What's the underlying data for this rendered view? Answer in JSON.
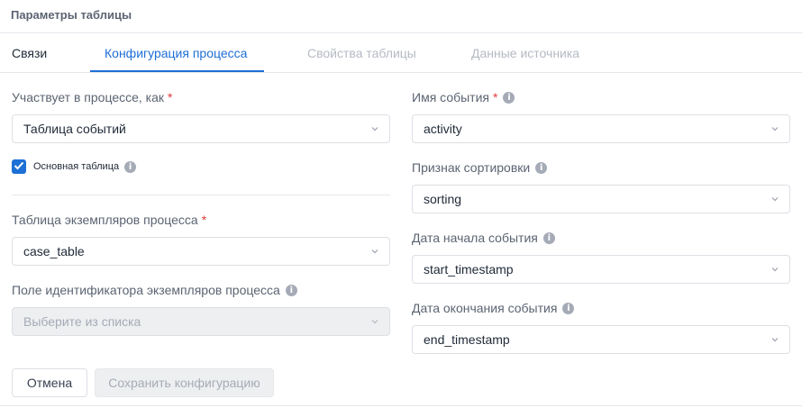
{
  "panel": {
    "title": "Параметры таблицы"
  },
  "tabs": [
    {
      "label": "Связи",
      "state": "normal"
    },
    {
      "label": "Конфигурация процесса",
      "state": "active"
    },
    {
      "label": "Свойства таблицы",
      "state": "disabled"
    },
    {
      "label": "Данные источника",
      "state": "disabled"
    }
  ],
  "left": {
    "participates": {
      "label": "Участвует в процессе, как",
      "required": "*",
      "value": "Таблица событий"
    },
    "main_table": {
      "label": "Основная таблица",
      "checked": true
    },
    "case_table": {
      "label": "Таблица экземпляров процесса",
      "required": "*",
      "value": "case_table"
    },
    "case_id": {
      "label": "Поле идентификатора экземпляров процесса",
      "placeholder": "Выберите из списка"
    }
  },
  "right": {
    "event_name": {
      "label": "Имя события",
      "required": "*",
      "value": "activity"
    },
    "sorting": {
      "label": "Признак сортировки",
      "value": "sorting"
    },
    "start": {
      "label": "Дата начала события",
      "value": "start_timestamp"
    },
    "end": {
      "label": "Дата окончания события",
      "value": "end_timestamp"
    }
  },
  "buttons": {
    "cancel": "Отмена",
    "save": "Сохранить конфигурацию"
  },
  "icons": {
    "info": "info-icon",
    "chevron": "chevron-down-icon",
    "check": "check-icon"
  },
  "colors": {
    "accent": "#1e6fd6",
    "required": "#e23b3b"
  }
}
